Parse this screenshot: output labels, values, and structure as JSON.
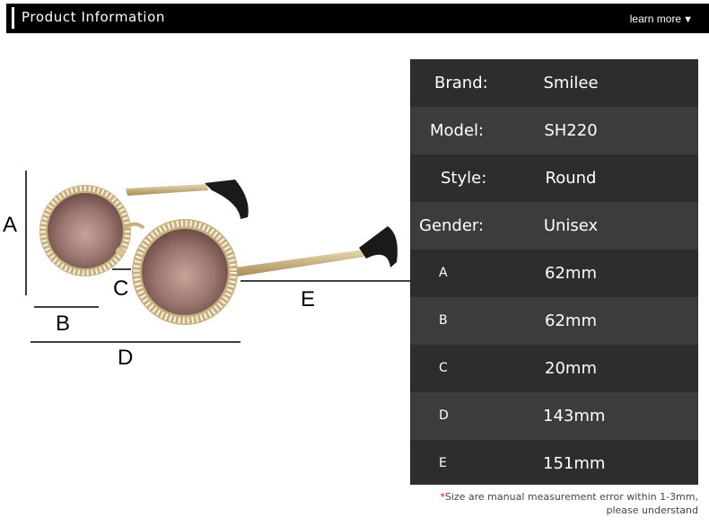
{
  "header": {
    "title": "Product Information",
    "learn_more": "learn more",
    "arrow": "▼"
  },
  "dimension_labels": {
    "a": "A",
    "b": "B",
    "c": "C",
    "d": "D",
    "e": "E"
  },
  "specs": [
    {
      "key": "Brand:",
      "value": "Smilee"
    },
    {
      "key": "Model:",
      "value": "SH220"
    },
    {
      "key": "Style:",
      "value": "Round"
    },
    {
      "key": "Gender:",
      "value": "Unisex"
    },
    {
      "key": "A",
      "value": "62mm"
    },
    {
      "key": "B",
      "value": "62mm"
    },
    {
      "key": "C",
      "value": "20mm"
    },
    {
      "key": "D",
      "value": "143mm"
    },
    {
      "key": "E",
      "value": "151mm"
    }
  ],
  "note": {
    "star": "*",
    "line1": "Size are manual measurement error within 1-3mm,",
    "line2": "please understand"
  },
  "colors": {
    "header_bg": "#000000",
    "row_dark": "#2d2d2d",
    "row_light": "#3c3c3c",
    "frame_gold": "#c9b07a",
    "lens": "#8a6660",
    "temple_tip": "#1a1a1a"
  }
}
